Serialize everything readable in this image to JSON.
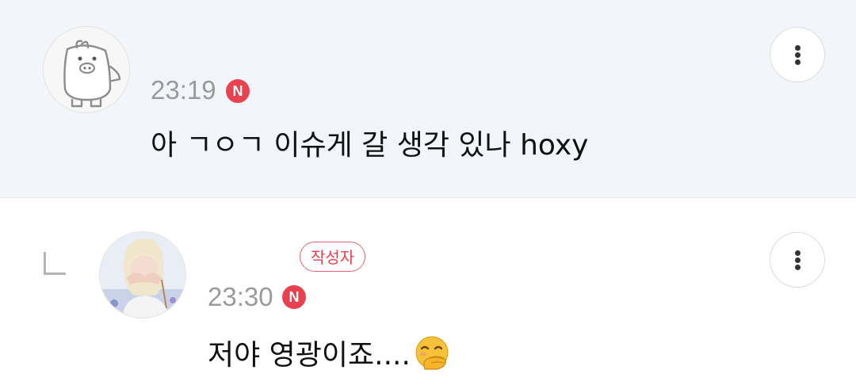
{
  "comments": [
    {
      "avatar": "pig-icon",
      "time": "23:19",
      "new_badge": "N",
      "text": "아 ㄱㅇㄱ 이슈게 갈 생각 있나 hoxy",
      "more_icon": "more-vertical-icon"
    },
    {
      "avatar": "profile-photo",
      "author_badge": "작성자",
      "time": "23:30",
      "new_badge": "N",
      "text": "저야 영광이죠....",
      "emoji": "face-with-hand-over-mouth-icon",
      "reply_icon": "reply-arrow-icon",
      "more_icon": "more-vertical-icon"
    }
  ],
  "colors": {
    "highlight_bg": "#f2f5fa",
    "badge_red": "#e8414f",
    "timestamp": "#9a9a9a"
  }
}
